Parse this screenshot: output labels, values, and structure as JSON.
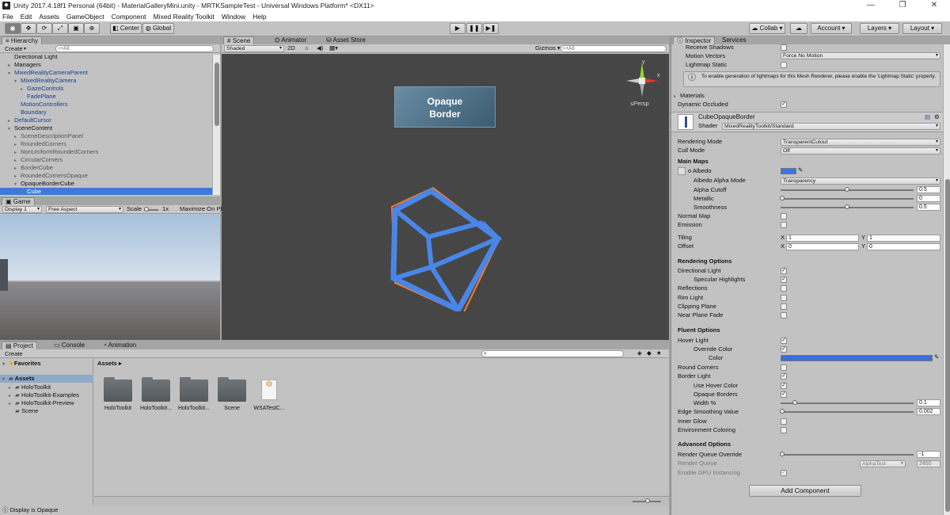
{
  "window": {
    "title": "Unity 2017.4.18f1 Personal (64bit) - MaterialGalleryMini.unity - MRTKSampleTest - Universal Windows Platform* <DX11>",
    "minimize": "—",
    "maximize": "❐",
    "close": "✕"
  },
  "menu": [
    "File",
    "Edit",
    "Assets",
    "GameObject",
    "Component",
    "Mixed Reality Toolkit",
    "Window",
    "Help"
  ],
  "toolbar": {
    "center": "Center",
    "global": "Global",
    "collab": "Collab",
    "account": "Account",
    "layers": "Layers",
    "layout": "Layout"
  },
  "hierarchy": {
    "tab": "Hierarchy",
    "create": "Create",
    "search": "▾All",
    "items": [
      {
        "label": "Directional Light",
        "indent": 1,
        "arrow": "",
        "color": "#111"
      },
      {
        "label": "Managers",
        "indent": 1,
        "arrow": "▸",
        "color": "#111"
      },
      {
        "label": "MixedRealityCameraParent",
        "indent": 1,
        "arrow": "▾",
        "color": "#1a3f8c"
      },
      {
        "label": "MixedRealityCamera",
        "indent": 2,
        "arrow": "▾",
        "color": "#1a3f8c"
      },
      {
        "label": "GazeControls",
        "indent": 3,
        "arrow": "▸",
        "color": "#1a3f8c"
      },
      {
        "label": "FadePlane",
        "indent": 3,
        "arrow": "",
        "color": "#1a3f8c"
      },
      {
        "label": "MotionControllers",
        "indent": 2,
        "arrow": "",
        "color": "#1a3f8c"
      },
      {
        "label": "Boundary",
        "indent": 2,
        "arrow": "",
        "color": "#1a3f8c"
      },
      {
        "label": "DefaultCursor",
        "indent": 1,
        "arrow": "▸",
        "color": "#1a3f8c"
      },
      {
        "label": "SceneContent",
        "indent": 1,
        "arrow": "▾",
        "color": "#111"
      },
      {
        "label": "SceneDescriptionPanel",
        "indent": 2,
        "arrow": "▸",
        "color": "#555"
      },
      {
        "label": "RoundedCorners",
        "indent": 2,
        "arrow": "▸",
        "color": "#555"
      },
      {
        "label": "NonUniformRoundedCorners",
        "indent": 2,
        "arrow": "▸",
        "color": "#555"
      },
      {
        "label": "CircularCorners",
        "indent": 2,
        "arrow": "▸",
        "color": "#555"
      },
      {
        "label": "BorderCube",
        "indent": 2,
        "arrow": "▸",
        "color": "#555"
      },
      {
        "label": "RoundedCornersOpaque",
        "indent": 2,
        "arrow": "▸",
        "color": "#555"
      },
      {
        "label": "OpaqueBorderCube",
        "indent": 2,
        "arrow": "▾",
        "color": "#111"
      },
      {
        "label": "Cube",
        "indent": 3,
        "arrow": "",
        "color": "#fff",
        "selected": true
      }
    ]
  },
  "game": {
    "tab": "Game",
    "display": "Display 1",
    "aspect": "Free Aspect",
    "scale": "Scale",
    "scale_value": "1x",
    "maximize": "Maximize On Pl"
  },
  "scene": {
    "tabs": [
      "Scene",
      "Animator",
      "Asset Store"
    ],
    "shaded": "Shaded",
    "mode2d": "2D",
    "gizmos": "Gizmos",
    "search": "▾All",
    "persp": "≤Persp",
    "panel_line1": "Opaque",
    "panel_line2": "Border",
    "axis_y": "y",
    "axis_x": "x"
  },
  "project": {
    "tabs": [
      "Project",
      "Console",
      "Animation"
    ],
    "create": "Create",
    "favorites": "Favorites",
    "assets_root": "Assets",
    "tree": [
      "HoloToolkit",
      "HoloToolkit-Examples",
      "HoloToolkit-Preview",
      "Scene"
    ],
    "breadcrumb": "Assets ▸",
    "items": [
      "HoloToolkit",
      "HoloToolkit...",
      "HoloToolkit...",
      "Scene",
      "WSATestC..."
    ]
  },
  "status": {
    "text": "Display is Opaque"
  },
  "inspector": {
    "tabs": [
      "Inspector",
      "Services"
    ],
    "top": {
      "receive_shadows": "Receive Shadows",
      "motion_vectors": "Motion Vectors",
      "motion_vectors_value": "Force No Motion",
      "lightmap_static": "Lightmap Static",
      "lightmap_info": "To enable generation of lightmaps for this Mesh Renderer, please enable the 'Lightmap Static' property.",
      "materials": "Materials",
      "dynamic_occluded": "Dynamic Occluded"
    },
    "material": {
      "name": "CubeOpaqueBorder",
      "shader_label": "Shader",
      "shader_value": "MixedRealityToolkit/Standard"
    },
    "props": {
      "rendering_mode": "Rendering Mode",
      "rendering_mode_value": "TransparentCutout",
      "cull_mode": "Cull Mode",
      "cull_mode_value": "Off",
      "main_maps": "Main Maps",
      "albedo": "Albedo",
      "albedo_alpha_mode": "Albedo Alpha Mode",
      "albedo_alpha_mode_value": "Transparency",
      "alpha_cutoff": "Alpha Cutoff",
      "alpha_cutoff_value": "0.5",
      "metallic": "Metallic",
      "metallic_value": "0",
      "smoothness": "Smoothness",
      "smoothness_value": "0.5",
      "normal_map": "Normal Map",
      "emission": "Emission",
      "tiling": "Tiling",
      "offset": "Offset",
      "tiling_x": "1",
      "tiling_y": "1",
      "offset_x": "0",
      "offset_y": "0",
      "x": "X",
      "y": "Y"
    },
    "rendering_options": {
      "title": "Rendering Options",
      "directional_light": "Directional Light",
      "specular_highlights": "Specular Highlights",
      "reflections": "Reflections",
      "rim_light": "Rim Light",
      "clipping_plane": "Clipping Plane",
      "near_plane_fade": "Near Plane Fade"
    },
    "fluent_options": {
      "title": "Fluent Options",
      "hover_light": "Hover Light",
      "override_color": "Override Color",
      "color": "Color",
      "round_corners": "Round Corners",
      "border_light": "Border Light",
      "use_hover_color": "Use Hover Color",
      "opaque_borders": "Opaque Borders",
      "width_pct": "Width %",
      "width_value": "0.1",
      "edge_smoothing": "Edge Smoothing Value",
      "edge_smoothing_value": "0.002",
      "inner_glow": "Inner Glow",
      "environment_coloring": "Environment Coloring"
    },
    "advanced": {
      "title": "Advanced Options",
      "render_queue_override": "Render Queue Override",
      "render_queue_override_value": "-1",
      "render_queue": "Render Queue",
      "render_queue_mode": "AlphaTest",
      "render_queue_value": "2450",
      "gpu_instancing": "Enable GPU Instancing"
    },
    "add_component": "Add Component"
  },
  "colors": {
    "accent": "#3d7be0",
    "selection": "#3e7bd9",
    "albedo": "#3f72e6",
    "hover_color": "#3a6fd8"
  }
}
